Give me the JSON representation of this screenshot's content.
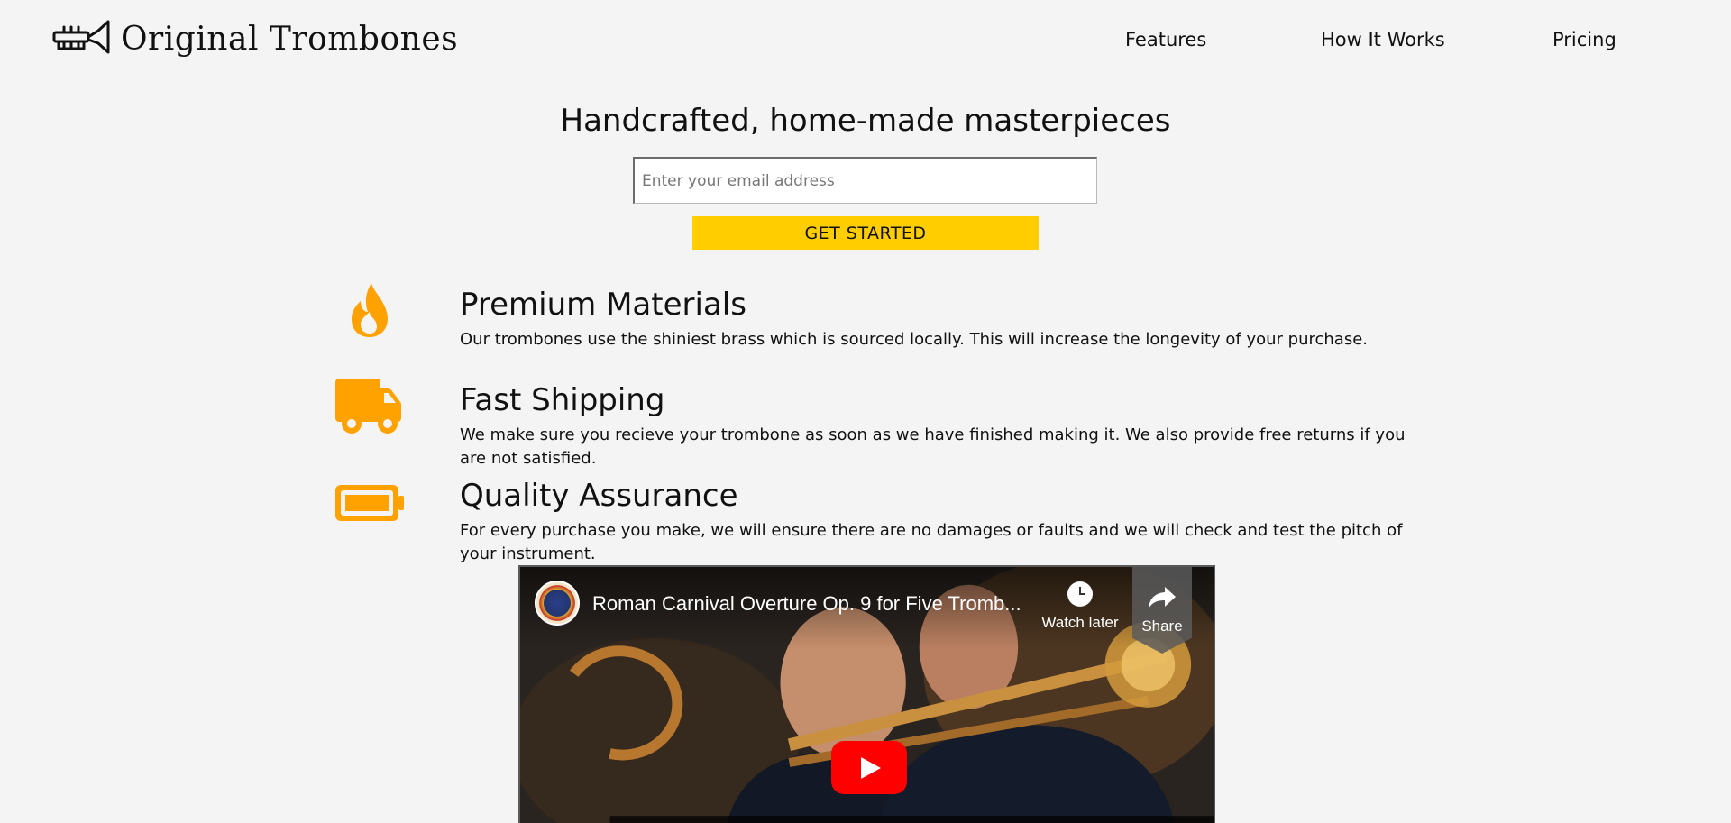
{
  "brand": {
    "name": "Original Trombones",
    "logo_icon": "trumpet-icon"
  },
  "nav": {
    "features": "Features",
    "how_it_works": "How It Works",
    "pricing": "Pricing"
  },
  "hero": {
    "title": "Handcrafted, home-made masterpieces",
    "email_placeholder": "Enter your email address",
    "cta_label": "GET STARTED"
  },
  "features": [
    {
      "icon": "fire-icon",
      "title": "Premium Materials",
      "description": "Our trombones use the shiniest brass which is sourced locally. This will increase the longevity of your purchase."
    },
    {
      "icon": "truck-icon",
      "title": "Fast Shipping",
      "description": "We make sure you recieve your trombone as soon as we have finished making it. We also provide free returns if you are not satisfied."
    },
    {
      "icon": "battery-full-icon",
      "title": "Quality Assurance",
      "description": "For every purchase you make, we will ensure there are no damages or faults and we will check and test the pitch of your instrument."
    }
  ],
  "video": {
    "title": "Roman Carnival Overture Op. 9 for Five Tromb...",
    "watch_later_label": "Watch later",
    "share_label": "Share"
  },
  "colors": {
    "accent_yellow": "#ffcd00",
    "icon_orange": "#ffa200",
    "background": "#f4f4f4",
    "youtube_red": "#ff0000"
  }
}
